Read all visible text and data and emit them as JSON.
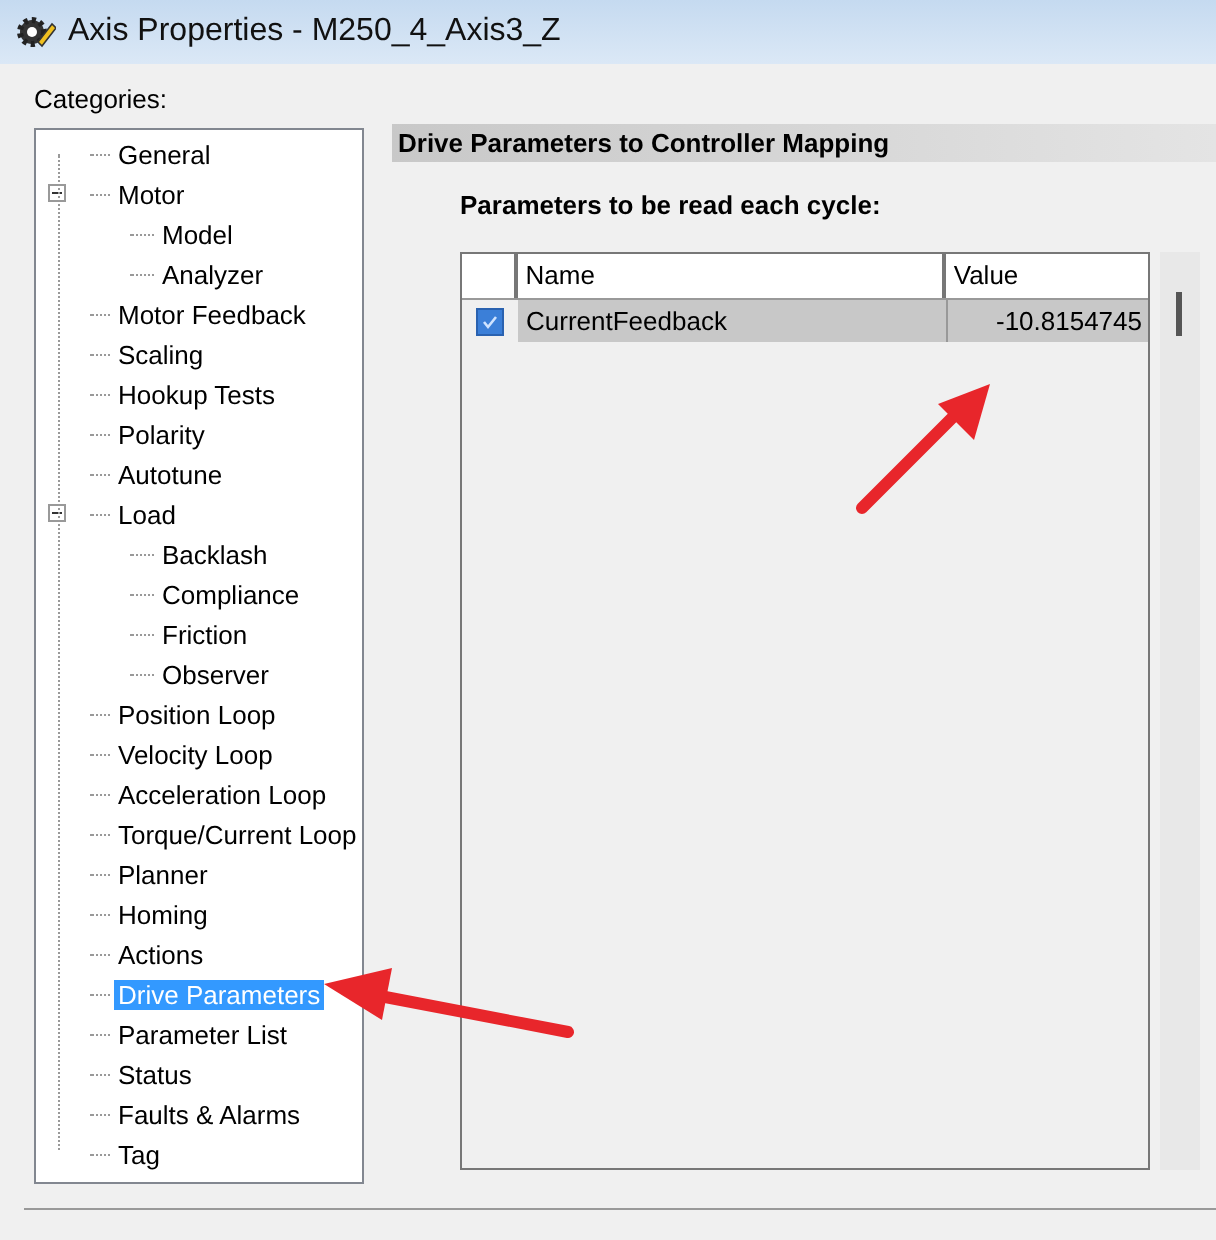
{
  "window": {
    "title": "Axis Properties - M250_4_Axis3_Z"
  },
  "categories": {
    "label": "Categories:",
    "items": [
      {
        "label": "General",
        "selected": false
      },
      {
        "label": "Motor",
        "selected": false,
        "expanded": true,
        "children": [
          {
            "label": "Model",
            "selected": false
          },
          {
            "label": "Analyzer",
            "selected": false
          }
        ]
      },
      {
        "label": "Motor Feedback",
        "selected": false
      },
      {
        "label": "Scaling",
        "selected": false
      },
      {
        "label": "Hookup Tests",
        "selected": false
      },
      {
        "label": "Polarity",
        "selected": false
      },
      {
        "label": "Autotune",
        "selected": false
      },
      {
        "label": "Load",
        "selected": false,
        "expanded": true,
        "children": [
          {
            "label": "Backlash",
            "selected": false
          },
          {
            "label": "Compliance",
            "selected": false
          },
          {
            "label": "Friction",
            "selected": false
          },
          {
            "label": "Observer",
            "selected": false
          }
        ]
      },
      {
        "label": "Position Loop",
        "selected": false
      },
      {
        "label": "Velocity Loop",
        "selected": false
      },
      {
        "label": "Acceleration Loop",
        "selected": false
      },
      {
        "label": "Torque/Current Loop",
        "selected": false
      },
      {
        "label": "Planner",
        "selected": false
      },
      {
        "label": "Homing",
        "selected": false
      },
      {
        "label": "Actions",
        "selected": false
      },
      {
        "label": "Drive Parameters",
        "selected": true
      },
      {
        "label": "Parameter List",
        "selected": false
      },
      {
        "label": "Status",
        "selected": false
      },
      {
        "label": "Faults & Alarms",
        "selected": false
      },
      {
        "label": "Tag",
        "selected": false
      }
    ]
  },
  "panel": {
    "title": "Drive Parameters to Controller Mapping",
    "subtitle": "Parameters to be read each cycle:",
    "table": {
      "columns": [
        "Name",
        "Value"
      ],
      "rows": [
        {
          "checked": true,
          "name": "CurrentFeedback",
          "value": "-10.8154745"
        }
      ]
    }
  }
}
